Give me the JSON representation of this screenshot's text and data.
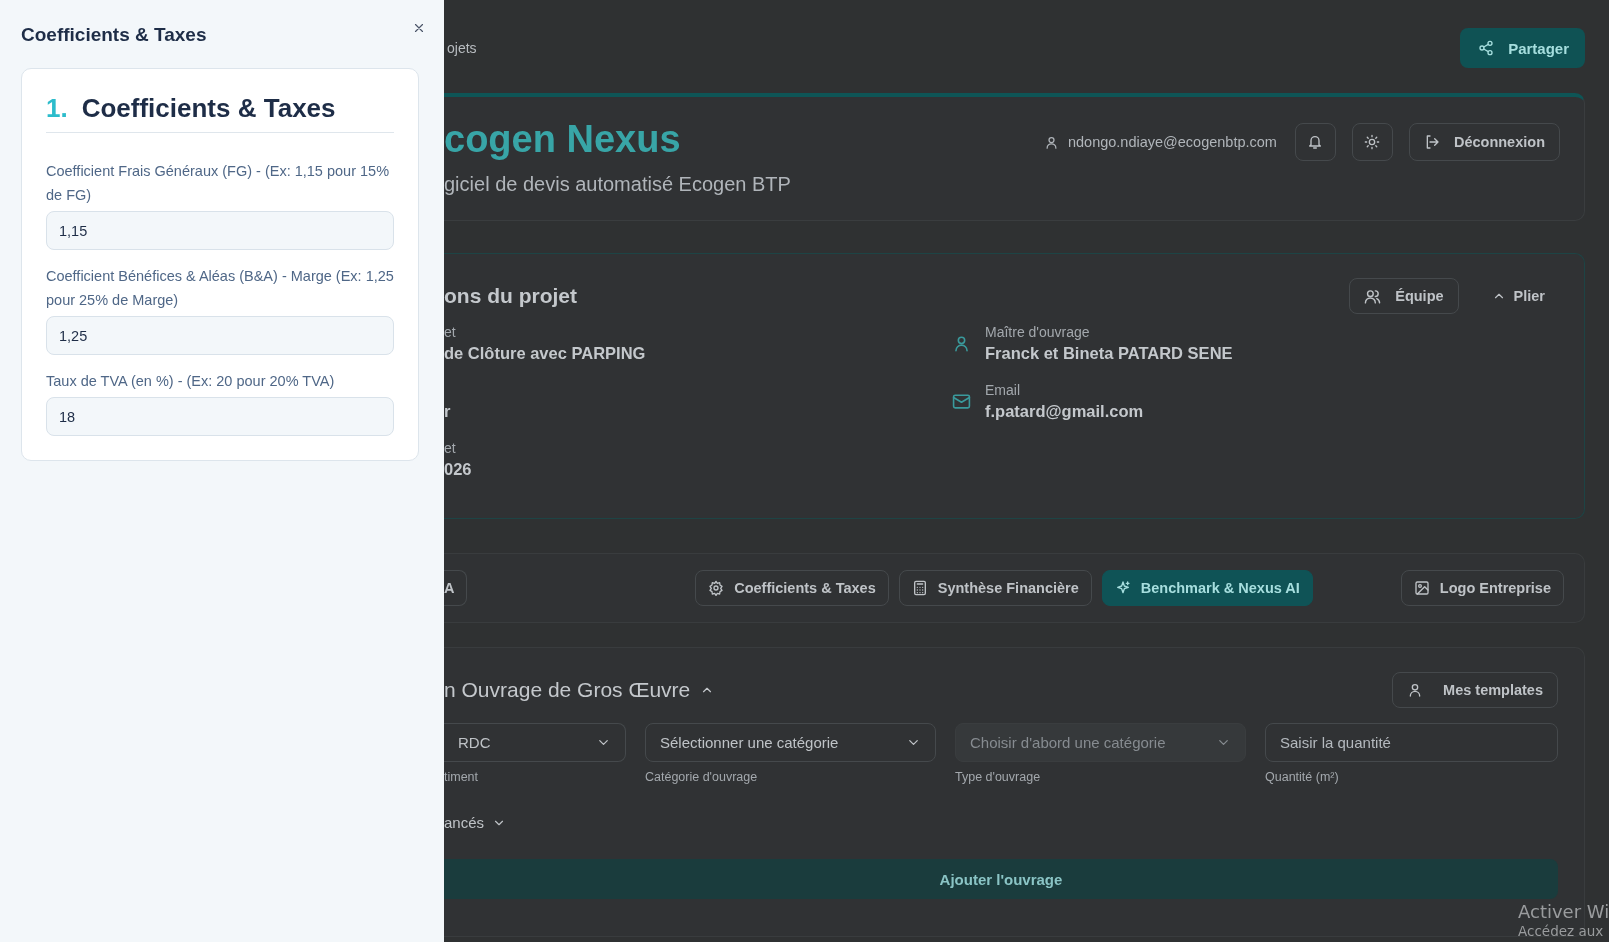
{
  "drawer": {
    "title": "Coefficients & Taxes",
    "section": {
      "number": "1.",
      "title": "Coefficients & Taxes"
    },
    "fields": [
      {
        "label": "Coefficient Frais Généraux (FG) - (Ex: 1,15 pour 15% de FG)",
        "value": "1,15"
      },
      {
        "label": "Coefficient Bénéfices & Aléas (B&A) - Marge (Ex: 1,25 pour 25% de Marge)",
        "value": "1,25"
      },
      {
        "label": "Taux de TVA (en %) - (Ex: 20 pour 20% TVA)",
        "value": "18"
      }
    ]
  },
  "page": {
    "breadcrumb": "ojets",
    "share_button": "Partager",
    "header": {
      "title": "cogen Nexus",
      "subtitle": "giciel de devis automatisé Ecogen BTP",
      "user_email": "ndongo.ndiaye@ecogenbtp.com",
      "logout_button": "Déconnexion"
    },
    "project": {
      "title": "ons du projet",
      "team_button": "Équipe",
      "collapse_button": "Plier",
      "left_fields": [
        {
          "label": "et",
          "value": "de Clôture avec PARPING"
        },
        {
          "value": "r"
        },
        {
          "label": "et",
          "value": "026"
        }
      ],
      "right_fields": [
        {
          "kind": "person",
          "label": "Maître d'ouvrage",
          "value": "Franck et Bineta PATARD SENE"
        },
        {
          "kind": "email",
          "label": "Email",
          "value": "f.patard@gmail.com"
        }
      ]
    },
    "tabs": [
      {
        "kind": "plain",
        "label": "A",
        "selected": false
      },
      {
        "kind": "gear",
        "label": "Coefficients & Taxes",
        "selected": false
      },
      {
        "kind": "calculator",
        "label": "Synthèse Financière",
        "selected": false
      },
      {
        "kind": "sparkle",
        "label": "Benchmark & Nexus AI",
        "selected": true
      },
      {
        "kind": "image",
        "label": "Logo Entreprise",
        "selected": false
      }
    ],
    "ouvrage": {
      "title": "n Ouvrage de Gros Œuvre",
      "templates_button": "Mes templates",
      "inputs": [
        {
          "kind": "select",
          "value": "RDC",
          "label": "timent",
          "disabled": false
        },
        {
          "kind": "select",
          "value": "Sélectionner une catégorie",
          "label": "Catégorie d'ouvrage",
          "disabled": false
        },
        {
          "kind": "select",
          "placeholder": "Choisir d'abord une catégorie",
          "label": "Type d'ouvrage",
          "disabled": true
        },
        {
          "kind": "input",
          "placeholder": "Saisir la quantité",
          "label": "Quantité (m²)",
          "disabled": false
        }
      ],
      "advanced_toggle": "ancés",
      "add_button": "Ajouter l'ouvrage"
    }
  },
  "os_notice": {
    "title": "Activer Wi",
    "text": "Accédez aux"
  }
}
